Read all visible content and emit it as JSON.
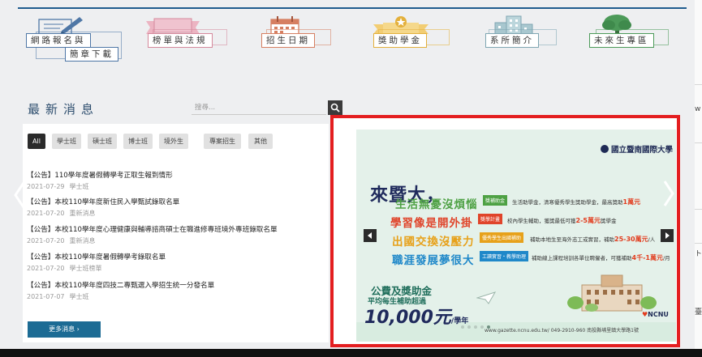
{
  "nav": [
    {
      "label_line1": "網路報名與",
      "label_line2": "簡章下載",
      "icon": "pen-paper-icon",
      "color": "#4f77a6"
    },
    {
      "label_line1": "榜單與法規",
      "icon": "ribbon-banner-icon",
      "color": "#d5899c"
    },
    {
      "label_line1": "招生日期",
      "icon": "calendar-icon",
      "color": "#d67f61"
    },
    {
      "label_line1": "獎助學金",
      "icon": "trophy-banner-icon",
      "color": "#e3b03c"
    },
    {
      "label_line1": "系所簡介",
      "icon": "buildings-icon",
      "color": "#7fa6b2"
    },
    {
      "label_line1": "未來生專區",
      "icon": "tree-icon",
      "color": "#4c9a59"
    }
  ],
  "news": {
    "title": "最新消息",
    "search_placeholder": "搜尋...",
    "tabs": [
      {
        "label": "All",
        "active": true
      },
      {
        "label": "學士班",
        "active": false
      },
      {
        "label": "碩士班",
        "active": false
      },
      {
        "label": "博士班",
        "active": false
      },
      {
        "label": "境外生",
        "active": false
      },
      {
        "label": "專案招生",
        "active": false
      },
      {
        "label": "其他",
        "active": false
      }
    ],
    "items": [
      {
        "title": "【公告】110學年度暑假轉學考正取生報到情形",
        "date": "2021-07-29",
        "category": "學士班"
      },
      {
        "title": "【公告】本校110學年度新住民入學甄試錄取名單",
        "date": "2021-07-20",
        "category": "重新消息"
      },
      {
        "title": "【公告】本校110學年度心理健康與輔導諮商碩士在職進修專班境外專班錄取名單",
        "date": "2021-07-20",
        "category": "重新消息"
      },
      {
        "title": "【公告】本校110學年度暑假轉學考錄取名單",
        "date": "2021-07-20",
        "category": "學士班榜單"
      },
      {
        "title": "【公告】本校110學年度四技二專甄選入學招生統一分發名單",
        "date": "2021-07-07",
        "category": "學士班"
      }
    ],
    "more_label": "更多消息 ›"
  },
  "slide": {
    "university": "國立暨南國際大學",
    "headline": "來暨大，",
    "rows": [
      {
        "big": "生活無憂沒煩惱",
        "tag": "獎補助金",
        "desc_pre": "生活助學金，清寒優秀學生獎助學金，最高獎助",
        "desc_hi": "1萬元",
        "desc_post": "",
        "color": "#4ea144"
      },
      {
        "big": "學習像是開外掛",
        "tag": "獎學計畫",
        "desc_pre": "校內學生輔助，獲獎最低可獲",
        "desc_hi": "2-5萬元",
        "desc_post": "獎學金",
        "color": "#e0442a"
      },
      {
        "big": "出國交換沒壓力",
        "tag": "優秀學生出國補助",
        "desc_pre": "補助本地生至海外志工或實習，補助",
        "desc_hi": "25-30萬元",
        "desc_post": "/人",
        "color": "#e7a11a"
      },
      {
        "big": "職涯發展夢很大",
        "tag": "工讀實習・教學助理",
        "desc_pre": "補助線上課程培訓各單位聘僱者，可獲補助",
        "desc_hi": "4千-1萬元",
        "desc_post": "/月",
        "color": "#1f88c9"
      }
    ],
    "sub1": "公費及獎助金",
    "sub2": "平均每生補助超過",
    "amount": "10,000元",
    "amount_unit": "/學年",
    "footer": "www.gazette.ncnu.edu.tw/  049-2910-960  南投縣埔里鎮大學路1號",
    "ncnu": "NCNU"
  },
  "right_strip": {
    "top_char": "w",
    "mid_char": "ト",
    "low_char": "臺"
  },
  "colors": {
    "frame": "#e41e20",
    "more_button": "#1c6b94",
    "topline": "#1f5c8e"
  }
}
